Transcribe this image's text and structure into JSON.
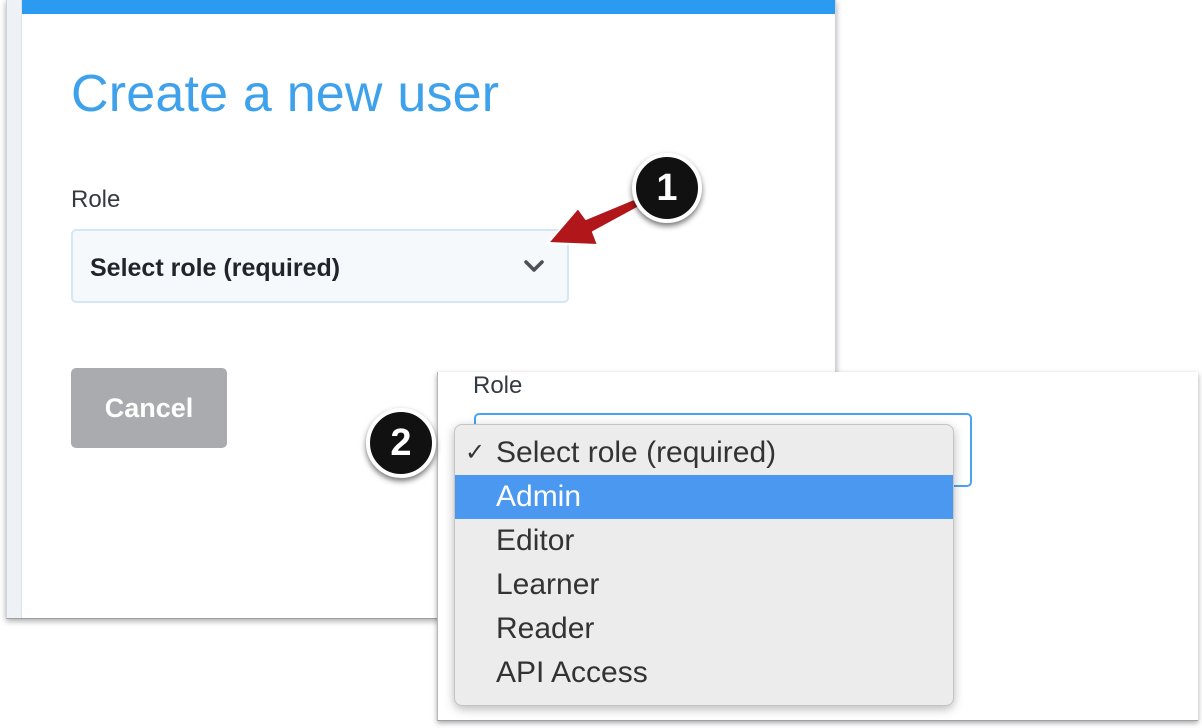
{
  "dialog": {
    "title": "Create a new user",
    "role_label": "Role",
    "role_select_value": "Select role (required)",
    "cancel_label": "Cancel",
    "accent_color": "#3ea1ec"
  },
  "zoom_inset": {
    "role_label": "Role",
    "role_options": [
      {
        "label": "Select role (required)",
        "checked": true,
        "highlighted": false
      },
      {
        "label": "Admin",
        "checked": false,
        "highlighted": true
      },
      {
        "label": "Editor",
        "checked": false,
        "highlighted": false
      },
      {
        "label": "Learner",
        "checked": false,
        "highlighted": false
      },
      {
        "label": "Reader",
        "checked": false,
        "highlighted": false
      },
      {
        "label": "API Access",
        "checked": false,
        "highlighted": false
      }
    ],
    "check_mark": "✓",
    "highlight_color": "#4a98ef"
  },
  "callouts": {
    "marker_1": "1",
    "marker_2": "2",
    "arrow_color": "#b0161a"
  }
}
